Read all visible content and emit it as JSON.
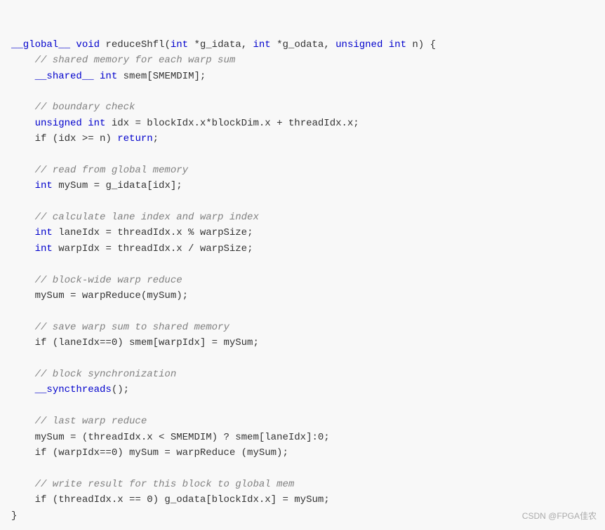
{
  "code": {
    "lines": [
      {
        "type": "normal",
        "text": "__global__ void reduceShfl(int *g_idata, int *g_odata, unsigned int n) {"
      },
      {
        "type": "comment",
        "text": "    // shared memory for each warp sum"
      },
      {
        "type": "normal",
        "text": "    __shared__ int smem[SMEMDIM];"
      },
      {
        "type": "blank",
        "text": ""
      },
      {
        "type": "comment",
        "text": "    // boundary check"
      },
      {
        "type": "normal",
        "text": "    unsigned int idx = blockIdx.x*blockDim.x + threadIdx.x;"
      },
      {
        "type": "normal",
        "text": "    if (idx >= n) return;"
      },
      {
        "type": "blank",
        "text": ""
      },
      {
        "type": "comment",
        "text": "    // read from global memory"
      },
      {
        "type": "normal",
        "text": "    int mySum = g_idata[idx];"
      },
      {
        "type": "blank",
        "text": ""
      },
      {
        "type": "comment",
        "text": "    // calculate lane index and warp index"
      },
      {
        "type": "normal",
        "text": "    int laneIdx = threadIdx.x % warpSize;"
      },
      {
        "type": "normal",
        "text": "    int warpIdx = threadIdx.x / warpSize;"
      },
      {
        "type": "blank",
        "text": ""
      },
      {
        "type": "comment",
        "text": "    // block-wide warp reduce"
      },
      {
        "type": "normal",
        "text": "    mySum = warpReduce(mySum);"
      },
      {
        "type": "blank",
        "text": ""
      },
      {
        "type": "comment",
        "text": "    // save warp sum to shared memory"
      },
      {
        "type": "normal",
        "text": "    if (laneIdx==0) smem[warpIdx] = mySum;"
      },
      {
        "type": "blank",
        "text": ""
      },
      {
        "type": "comment",
        "text": "    // block synchronization"
      },
      {
        "type": "normal",
        "text": "    __syncthreads();"
      },
      {
        "type": "blank",
        "text": ""
      },
      {
        "type": "comment",
        "text": "    // last warp reduce"
      },
      {
        "type": "normal",
        "text": "    mySum = (threadIdx.x < SMEMDIM) ? smem[laneIdx]:0;"
      },
      {
        "type": "normal",
        "text": "    if (warpIdx==0) mySum = warpReduce (mySum);"
      },
      {
        "type": "blank",
        "text": ""
      },
      {
        "type": "comment",
        "text": "    // write result for this block to global mem"
      },
      {
        "type": "normal",
        "text": "    if (threadIdx.x == 0) g_odata[blockIdx.x] = mySum;"
      },
      {
        "type": "normal",
        "text": "}"
      }
    ],
    "watermark": "CSDN @FPGA佳农"
  }
}
